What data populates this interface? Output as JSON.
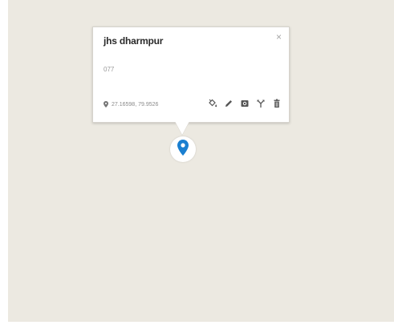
{
  "popup": {
    "title": "jhs dharmpur",
    "description": "077",
    "coordinates": "27.16598, 79.9526",
    "close_label": "×",
    "tools": [
      {
        "icon": "paint-bucket-icon"
      },
      {
        "icon": "pencil-icon"
      },
      {
        "icon": "camera-icon"
      },
      {
        "icon": "route-icon"
      },
      {
        "icon": "trash-icon"
      }
    ]
  },
  "marker": {
    "icon": "location-pin-icon",
    "color": "#1a7fd0"
  },
  "colors": {
    "map_background": "#ece9e1",
    "popup_background": "#ffffff",
    "icon_color": "#555555"
  }
}
